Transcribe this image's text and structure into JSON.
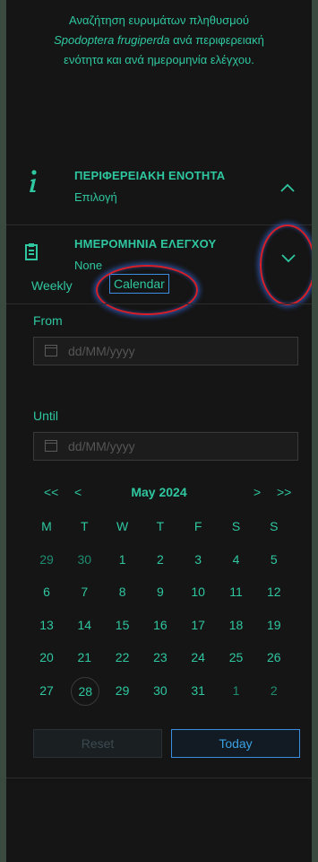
{
  "intro": {
    "line1": "Αναζήτηση ευρυμάτων πληθυσμού",
    "line2_em": "Spodoptera frugiperda",
    "line2_rest": " ανά περιφερειακή",
    "line3": "ενότητα και ανά ημερομηνία ελέγχου."
  },
  "region": {
    "title": "ΠΕΡΙΦΕΡΕΙΑΚΗ ΕΝΟΤΗΤΑ",
    "subtitle": "Επιλογή"
  },
  "date": {
    "title": "ΗΜΕΡΟΜΗΝΙΑ ΕΛΕΓΧΟΥ",
    "subtitle": "None"
  },
  "tabs": {
    "weekly": "Weekly",
    "calendar": "Calendar"
  },
  "from": {
    "label": "From",
    "placeholder": "dd/MM/yyyy"
  },
  "until": {
    "label": "Until",
    "placeholder": "dd/MM/yyyy"
  },
  "calendar": {
    "prev_year": "<<",
    "prev_month": "<",
    "month_label": "May 2024",
    "next_month": ">",
    "next_year": ">>",
    "weekdays": [
      "M",
      "T",
      "W",
      "T",
      "F",
      "S",
      "S"
    ],
    "weeks": [
      [
        "29",
        "30",
        "1",
        "2",
        "3",
        "4",
        "5"
      ],
      [
        "6",
        "7",
        "8",
        "9",
        "10",
        "11",
        "12"
      ],
      [
        "13",
        "14",
        "15",
        "16",
        "17",
        "18",
        "19"
      ],
      [
        "20",
        "21",
        "22",
        "23",
        "24",
        "25",
        "26"
      ],
      [
        "27",
        "28",
        "29",
        "30",
        "31",
        "1",
        "2"
      ]
    ],
    "today": "28"
  },
  "buttons": {
    "reset": "Reset",
    "today": "Today"
  },
  "colors": {
    "accent": "#2fc7a0",
    "background": "#151515",
    "highlight_ring": "#d8202a",
    "focus_blue": "#3a8de0"
  }
}
